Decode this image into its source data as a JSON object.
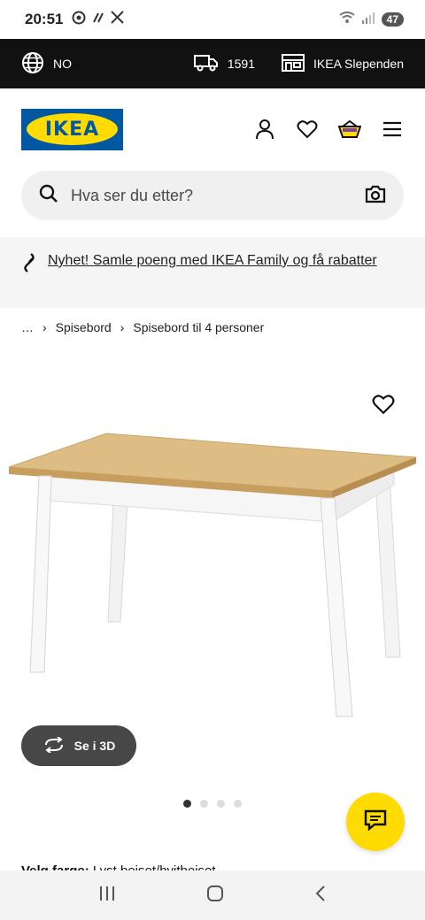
{
  "status_bar": {
    "time": "20:51",
    "battery": "47"
  },
  "topbar": {
    "language": "NO",
    "postcode": "1591",
    "store": "IKEA Slependen"
  },
  "header": {
    "logo_text": "IKEA"
  },
  "search": {
    "placeholder": "Hva ser du etter?"
  },
  "promo": {
    "text": "Nyhet! Samle poeng med IKEA Family og få rabatter"
  },
  "breadcrumb": {
    "items": [
      "…",
      "Spisebord",
      "Spisebord til 4 personer"
    ]
  },
  "product": {
    "view_3d_label": "Se i 3D",
    "image_count": 4,
    "active_image": 1,
    "color_label": "Velg farge:",
    "color_value": "Lyst beiset/hvitbeiset"
  },
  "colors": {
    "brand_blue": "#0058a3",
    "brand_yellow": "#ffdb00",
    "topbar": "#111111"
  }
}
